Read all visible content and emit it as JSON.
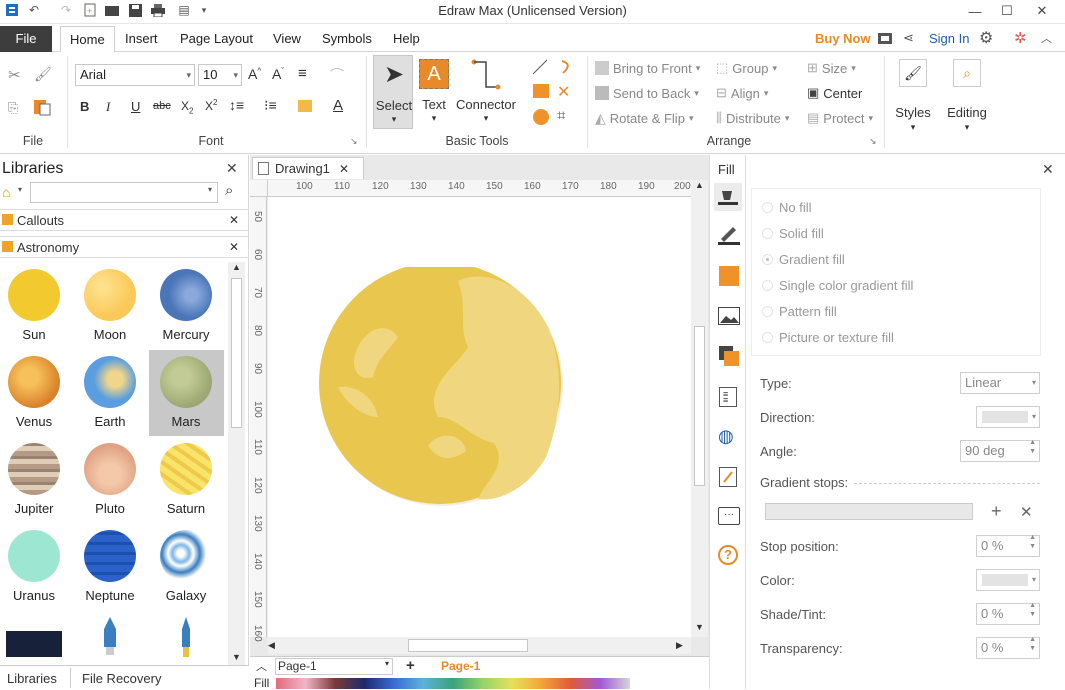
{
  "window": {
    "title": "Edraw Max (Unlicensed Version)"
  },
  "menu": {
    "file": "File",
    "tabs": [
      "Home",
      "Insert",
      "Page Layout",
      "View",
      "Symbols",
      "Help"
    ],
    "buy_now": "Buy Now",
    "sign_in": "Sign In"
  },
  "ribbon": {
    "file_group": "File",
    "font_group": "Font",
    "font_name": "Arial",
    "font_size": "10",
    "basic_tools_group": "Basic Tools",
    "select": "Select",
    "text": "Text",
    "connector": "Connector",
    "arrange_group": "Arrange",
    "bring_to_front": "Bring to Front",
    "send_to_back": "Send to Back",
    "rotate_flip": "Rotate & Flip",
    "group": "Group",
    "align": "Align",
    "distribute": "Distribute",
    "size": "Size",
    "center": "Center",
    "protect": "Protect",
    "styles": "Styles",
    "editing": "Editing"
  },
  "libraries": {
    "title": "Libraries",
    "search_placeholder": "",
    "categories": [
      "Callouts",
      "Astronomy"
    ],
    "shapes": [
      {
        "label": "Sun",
        "color": "#f0c93a"
      },
      {
        "label": "Moon",
        "color": "#fbc95a"
      },
      {
        "label": "Mercury",
        "color": "#4a76b8"
      },
      {
        "label": "Venus",
        "color": "#e89a2a"
      },
      {
        "label": "Earth",
        "color": "#5a9de0"
      },
      {
        "label": "Mars",
        "color": "#a7b482"
      },
      {
        "label": "Jupiter",
        "color": "#c8a58a"
      },
      {
        "label": "Pluto",
        "color": "#e9b497"
      },
      {
        "label": "Saturn",
        "color": "#f6de5e"
      },
      {
        "label": "Uranus",
        "color": "#9de6d2"
      },
      {
        "label": "Neptune",
        "color": "#2a62c9"
      },
      {
        "label": "Galaxy",
        "color": "#3a7fc0"
      }
    ],
    "bottom_tabs": [
      "Libraries",
      "File Recovery"
    ]
  },
  "document": {
    "tab": "Drawing1",
    "ruler_h": [
      "100",
      "110",
      "120",
      "130",
      "140",
      "150",
      "160",
      "170",
      "180",
      "190",
      "200"
    ],
    "ruler_v": [
      "50",
      "60",
      "70",
      "80",
      "90",
      "100",
      "110",
      "120",
      "130",
      "140",
      "150",
      "160"
    ],
    "page_select": "Page-1",
    "page_tab": "Page-1",
    "fill_label": "Fill"
  },
  "fill_panel": {
    "title": "Fill",
    "options": [
      "No fill",
      "Solid fill",
      "Gradient fill",
      "Single color gradient fill",
      "Pattern fill",
      "Picture or texture fill"
    ],
    "selected": "Gradient fill",
    "type_label": "Type:",
    "type_value": "Linear",
    "direction_label": "Direction:",
    "angle_label": "Angle:",
    "angle_value": "90 deg",
    "gradient_stops_label": "Gradient stops:",
    "stop_position_label": "Stop position:",
    "stop_position_value": "0 %",
    "color_label": "Color:",
    "shade_label": "Shade/Tint:",
    "shade_value": "0 %",
    "transparency_label": "Transparency:",
    "transparency_value": "0 %"
  },
  "colors": {
    "accent": "#e8892a",
    "planet": "#e9c85a",
    "planet_light": "#f0d98a"
  }
}
